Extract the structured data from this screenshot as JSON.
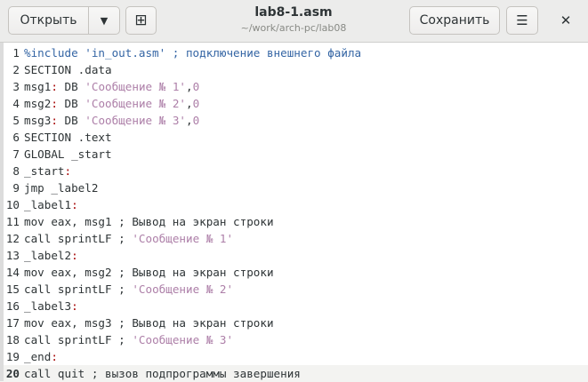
{
  "header": {
    "open_label": "Открыть",
    "title": "lab8-1.asm",
    "subtitle": "~/work/arch-pc/lab08",
    "save_label": "Сохранить",
    "dropdown_icon": "▼",
    "new_tab_icon": "⊞",
    "menu_icon": "☰",
    "close_icon": "✕"
  },
  "editor": {
    "current_line": 20,
    "lines": [
      {
        "n": "1",
        "t": [
          [
            "pp",
            "%include 'in_out.asm' ; подключение внешнего файла"
          ]
        ]
      },
      {
        "n": "2",
        "t": [
          [
            "",
            "SECTION .data"
          ]
        ]
      },
      {
        "n": "3",
        "t": [
          [
            "",
            "msg1"
          ],
          [
            "lbl",
            ":"
          ],
          [
            "",
            " DB "
          ],
          [
            "str",
            "'Сообщение № 1'"
          ],
          [
            "",
            ","
          ],
          [
            "num",
            "0"
          ]
        ]
      },
      {
        "n": "4",
        "t": [
          [
            "",
            "msg2"
          ],
          [
            "lbl",
            ":"
          ],
          [
            "",
            " DB "
          ],
          [
            "str",
            "'Сообщение № 2'"
          ],
          [
            "",
            ","
          ],
          [
            "num",
            "0"
          ]
        ]
      },
      {
        "n": "5",
        "t": [
          [
            "",
            "msg3"
          ],
          [
            "lbl",
            ":"
          ],
          [
            "",
            " DB "
          ],
          [
            "str",
            "'Сообщение № 3'"
          ],
          [
            "",
            ","
          ],
          [
            "num",
            "0"
          ]
        ]
      },
      {
        "n": "6",
        "t": [
          [
            "",
            "SECTION .text"
          ]
        ]
      },
      {
        "n": "7",
        "t": [
          [
            "",
            "GLOBAL _start"
          ]
        ]
      },
      {
        "n": "8",
        "t": [
          [
            "",
            "_start"
          ],
          [
            "lbl",
            ":"
          ]
        ]
      },
      {
        "n": "9",
        "t": [
          [
            "",
            "jmp _label2"
          ]
        ]
      },
      {
        "n": "10",
        "t": [
          [
            "",
            "_label1"
          ],
          [
            "lbl",
            ":"
          ]
        ]
      },
      {
        "n": "11",
        "t": [
          [
            "",
            "mov eax, msg1 ; Вывод на экран строки"
          ]
        ]
      },
      {
        "n": "12",
        "t": [
          [
            "",
            "call sprintLF ; "
          ],
          [
            "str",
            "'Сообщение № 1'"
          ]
        ]
      },
      {
        "n": "13",
        "t": [
          [
            "",
            "_label2"
          ],
          [
            "lbl",
            ":"
          ]
        ]
      },
      {
        "n": "14",
        "t": [
          [
            "",
            "mov eax, msg2 ; Вывод на экран строки"
          ]
        ]
      },
      {
        "n": "15",
        "t": [
          [
            "",
            "call sprintLF ; "
          ],
          [
            "str",
            "'Сообщение № 2'"
          ]
        ]
      },
      {
        "n": "16",
        "t": [
          [
            "",
            "_label3"
          ],
          [
            "lbl",
            ":"
          ]
        ]
      },
      {
        "n": "17",
        "t": [
          [
            "",
            "mov eax, msg3 ; Вывод на экран строки"
          ]
        ]
      },
      {
        "n": "18",
        "t": [
          [
            "",
            "call sprintLF ; "
          ],
          [
            "str",
            "'Сообщение № 3'"
          ]
        ]
      },
      {
        "n": "19",
        "t": [
          [
            "",
            "_end"
          ],
          [
            "lbl",
            ":"
          ]
        ]
      },
      {
        "n": "20",
        "t": [
          [
            "",
            "call quit ; вызов подпрограммы завершения"
          ]
        ]
      }
    ]
  }
}
